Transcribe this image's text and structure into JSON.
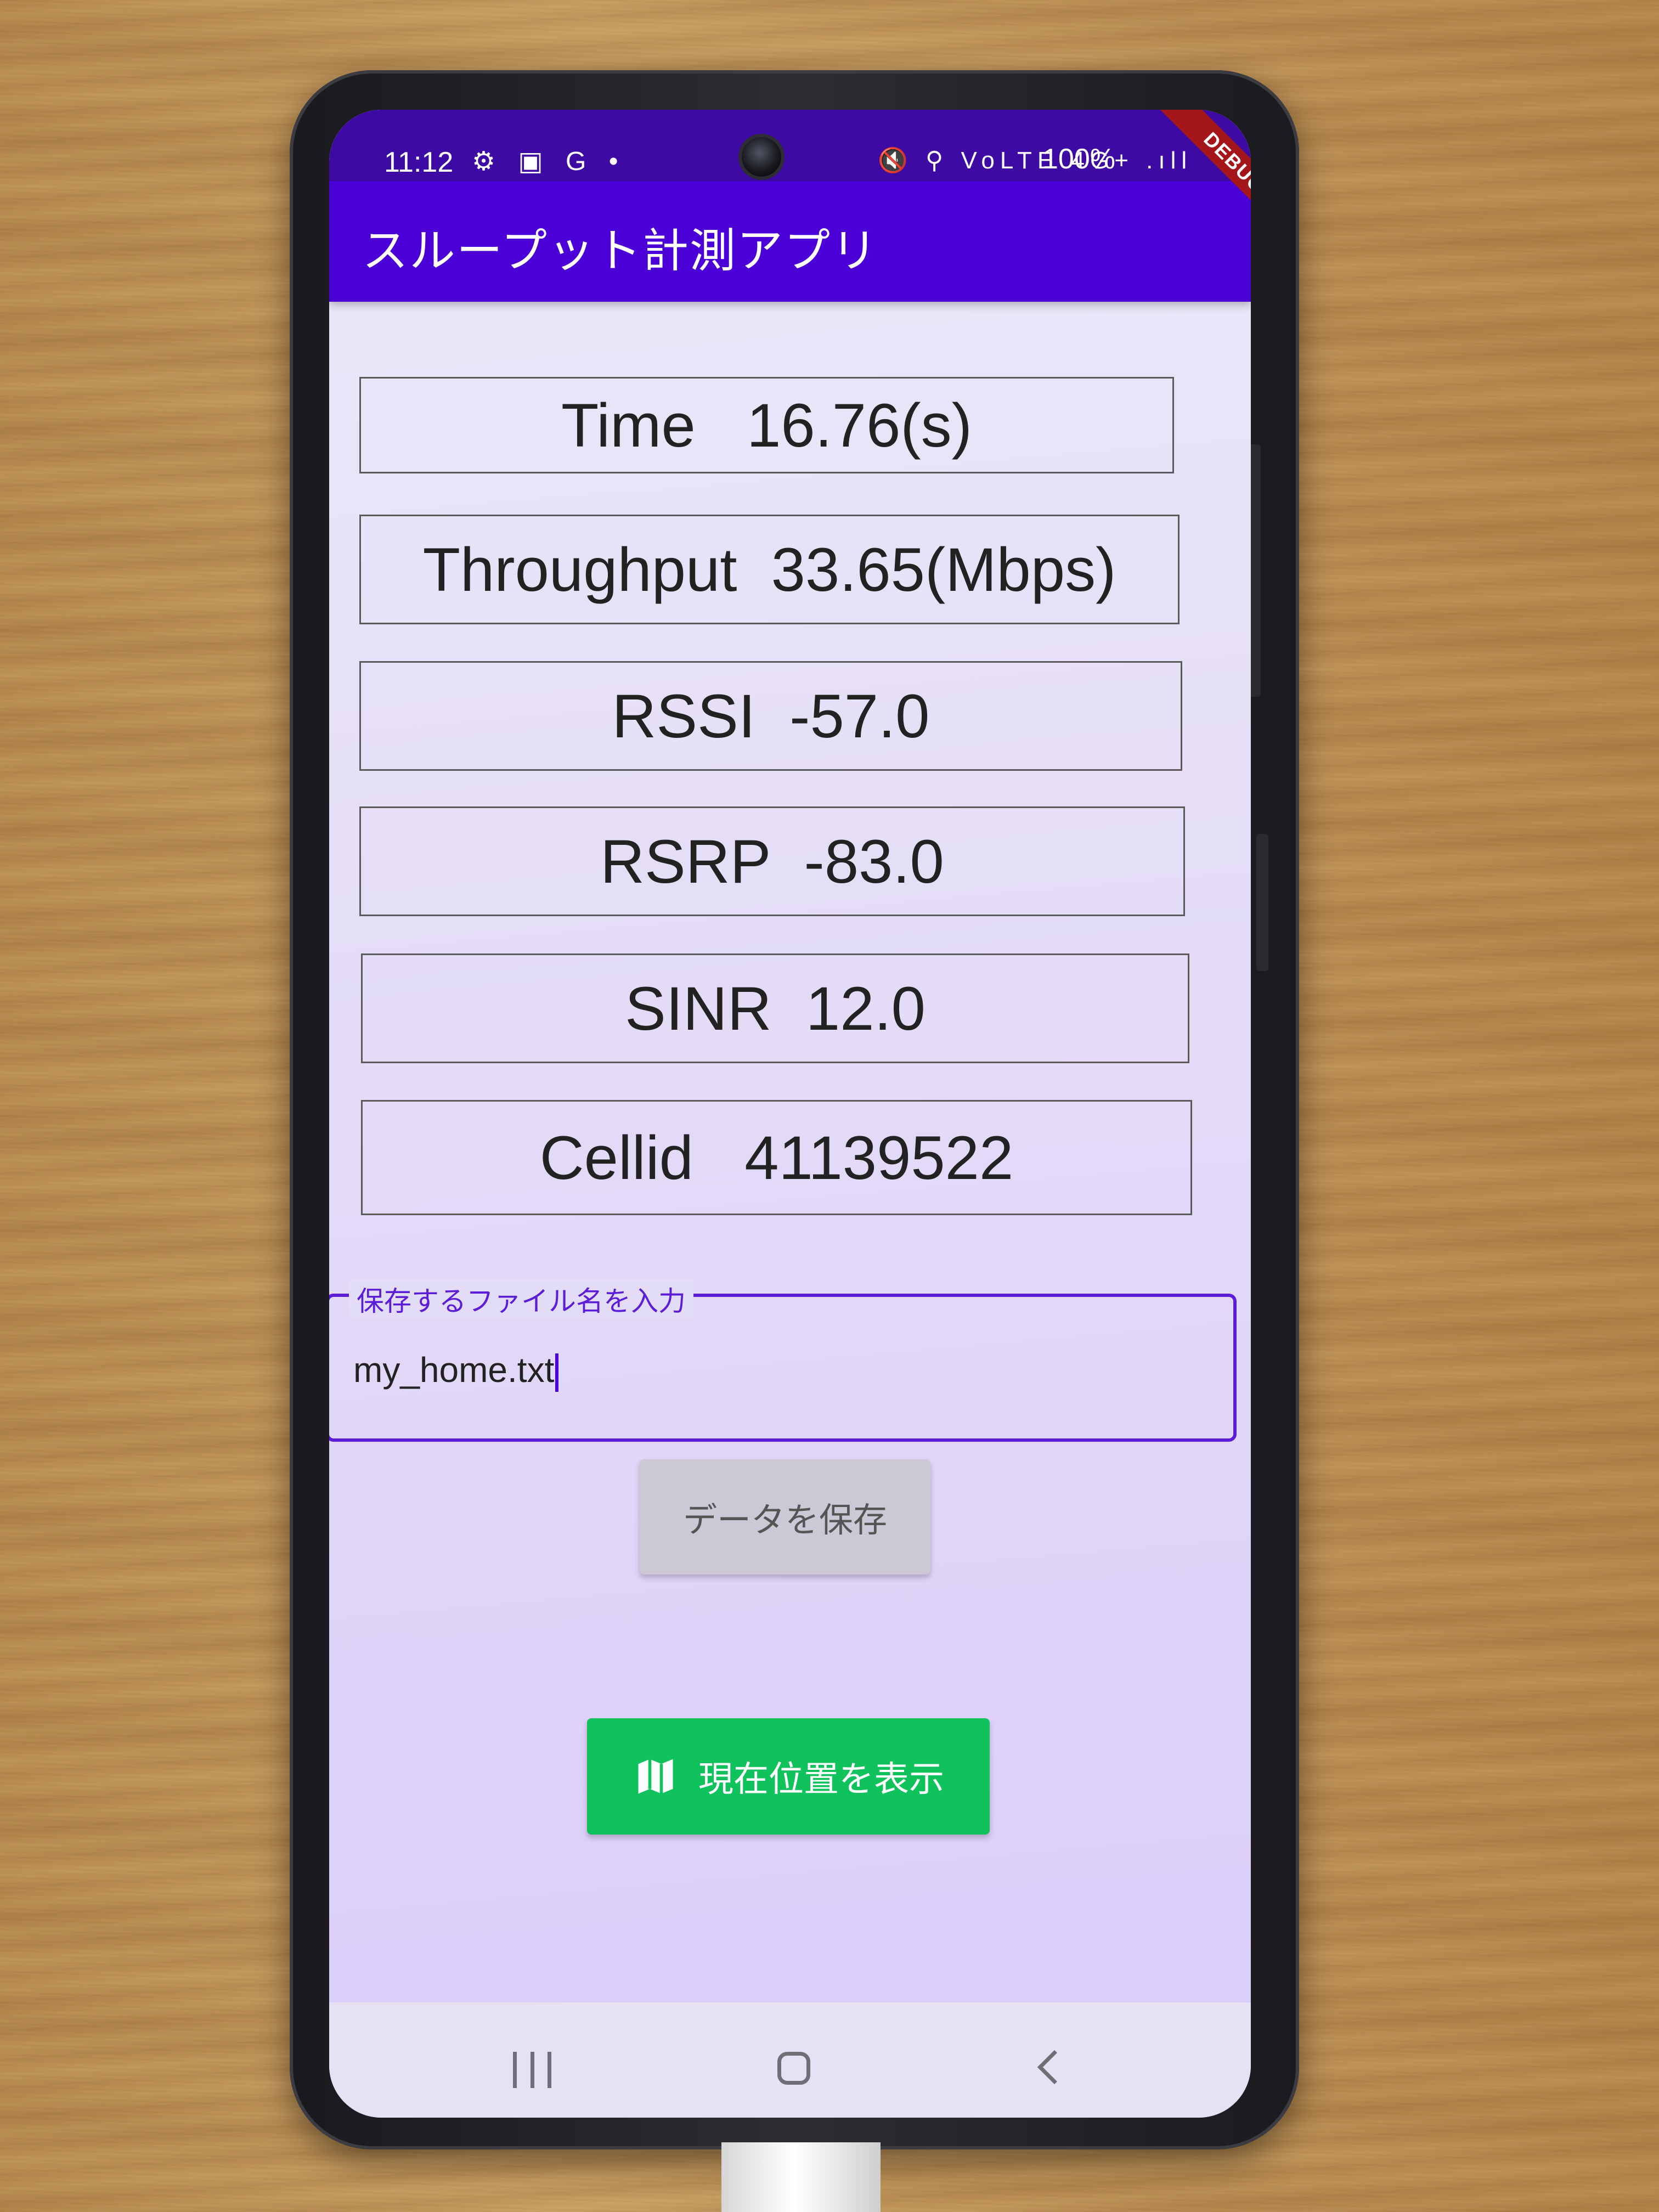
{
  "statusbar": {
    "time": "11:12",
    "left_icons": "⚙ ▣ G •",
    "right_icons": "🔇 ⚲ VoLTE 4G+ .ıll",
    "battery": "100%"
  },
  "appbar": {
    "title": "スループット計測アプリ",
    "debug_banner": "DEBUG"
  },
  "metrics": [
    {
      "label": "Time",
      "value": "16.76(s)"
    },
    {
      "label": "Throughput",
      "value": "33.65(Mbps)"
    },
    {
      "label": "RSSI",
      "value": "-57.0"
    },
    {
      "label": "RSRP",
      "value": "-83.0"
    },
    {
      "label": "SINR",
      "value": "12.0"
    },
    {
      "label": "Cellid",
      "value": "41139522"
    }
  ],
  "metric_text": {
    "time": "Time   16.76(s)",
    "throughput": "Throughput  33.65(Mbps)",
    "rssi": "RSSI  -57.0",
    "rsrp": "RSRP  -83.0",
    "sinr": "SINR  12.0",
    "cellid": "Cellid   41139522"
  },
  "filename_field": {
    "label": "保存するファイル名を入力",
    "value": "my_home.txt"
  },
  "buttons": {
    "save": "データを保存",
    "location": "現在位置を表示"
  },
  "colors": {
    "statusbar": "#3d0aa3",
    "appbar": "#4a00d6",
    "accent": "#5c1dd8",
    "location_button": "#0fc25c",
    "save_button": "#cdc8d6"
  }
}
